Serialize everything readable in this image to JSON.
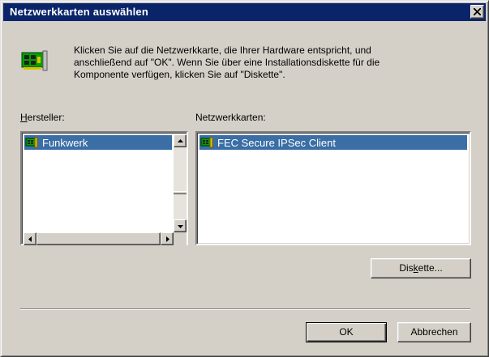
{
  "window": {
    "title": "Netzwerkkarten auswählen"
  },
  "icons": {
    "close": "close-icon",
    "network_card": "network-card-icon",
    "small_card": "network-card-small-icon"
  },
  "info": {
    "line1": "Klicken Sie auf die Netzwerkkarte, die Ihrer Hardware entspricht, und",
    "line2": "anschließend auf \"OK\".  Wenn Sie über eine Installationsdiskette für die",
    "line3": "Komponente verfügen, klicken Sie auf \"Diskette\"."
  },
  "manufacturers": {
    "label_accel": "H",
    "label_rest": "ersteller:",
    "items": [
      {
        "label": "Funkwerk",
        "selected": true
      }
    ]
  },
  "adapters": {
    "label": "Netzwerkkarten:",
    "items": [
      {
        "label": "FEC Secure IPSec Client",
        "selected": true
      }
    ]
  },
  "buttons": {
    "disk_pre": "Dis",
    "disk_accel": "k",
    "disk_post": "ette...",
    "ok": "OK",
    "cancel": "Abbrechen"
  },
  "colors": {
    "titlebar": "#0a246a",
    "selection": "#3a6ea5",
    "face": "#d4d0c8"
  }
}
